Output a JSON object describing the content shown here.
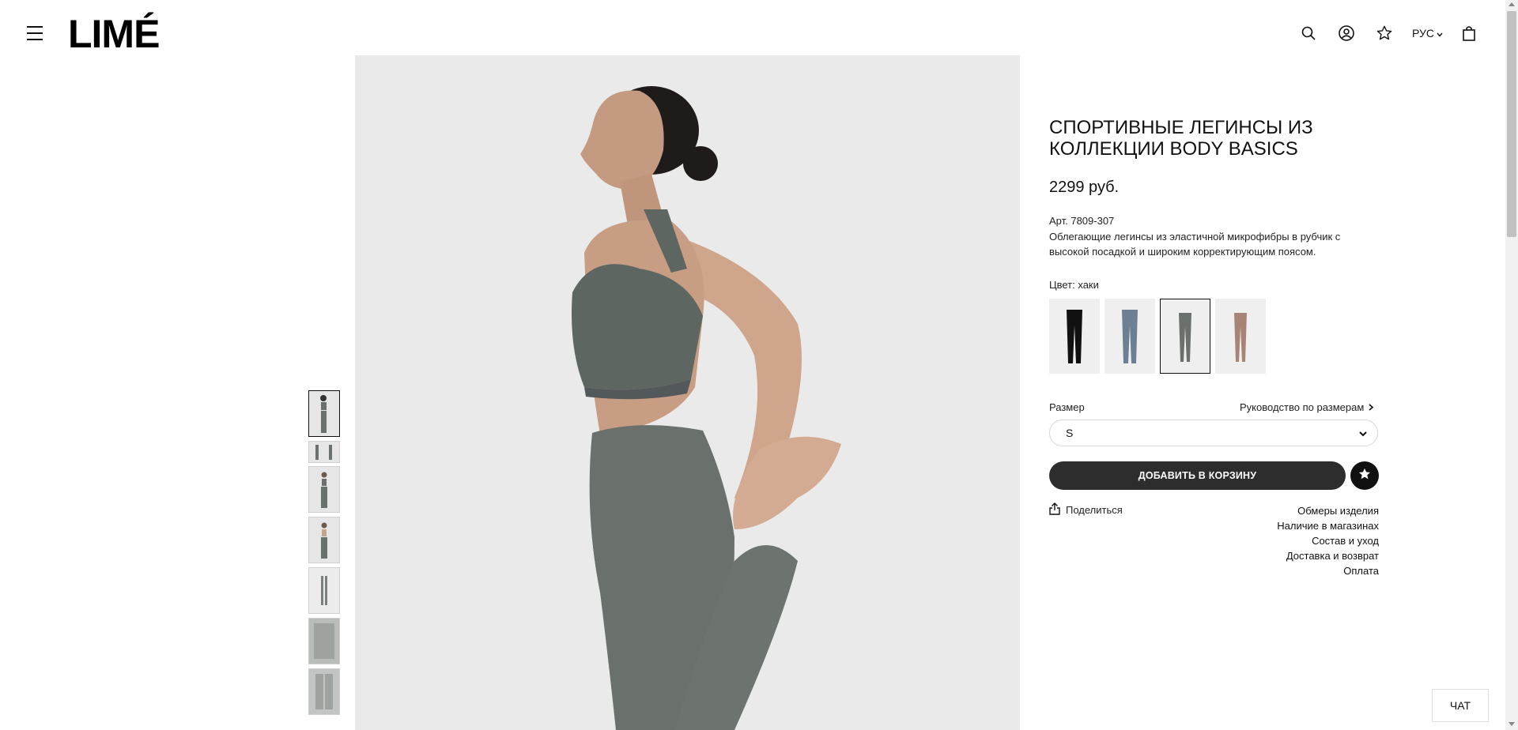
{
  "header": {
    "logo": "LIMÉ",
    "language": "РУС",
    "icons": [
      "menu-icon",
      "search-icon",
      "account-icon",
      "favorites-icon",
      "chevron-down-icon",
      "bag-icon"
    ]
  },
  "product": {
    "title": "СПОРТИВНЫЕ ЛЕГИНСЫ ИЗ КОЛЛЕКЦИИ BODY BASICS",
    "price": "2299 руб.",
    "article": "Арт. 7809-307",
    "description": "Облегающие легинсы из эластичной микрофибры в рубчик с высокой посадкой и широким корректирующим поясом.",
    "color_label": "Цвет: хаки",
    "colors": [
      {
        "name": "черный",
        "hex": "#111111"
      },
      {
        "name": "синий",
        "hex": "#6d7f92"
      },
      {
        "name": "хаки",
        "hex": "#6a716d",
        "selected": true
      },
      {
        "name": "бежевый",
        "hex": "#a78576"
      }
    ],
    "size_label": "Размер",
    "size_guide": "Руководство по размерам",
    "size_selected": "S",
    "add_to_cart": "ДОБАВИТЬ В КОРЗИНУ",
    "share": "Поделиться",
    "info_links": [
      "Обмеры изделия",
      "Наличие в магазинах",
      "Состав и уход",
      "Доставка и возврат",
      "Оплата"
    ]
  },
  "gallery": {
    "thumbnail_count": 7,
    "active_thumbnail": 1
  },
  "chat_button": "ЧАТ",
  "colors": {
    "text": "#111111",
    "button_dark": "#2d2d2d",
    "product_khaki": "#6a716d",
    "background_image": "#eaeaea"
  }
}
